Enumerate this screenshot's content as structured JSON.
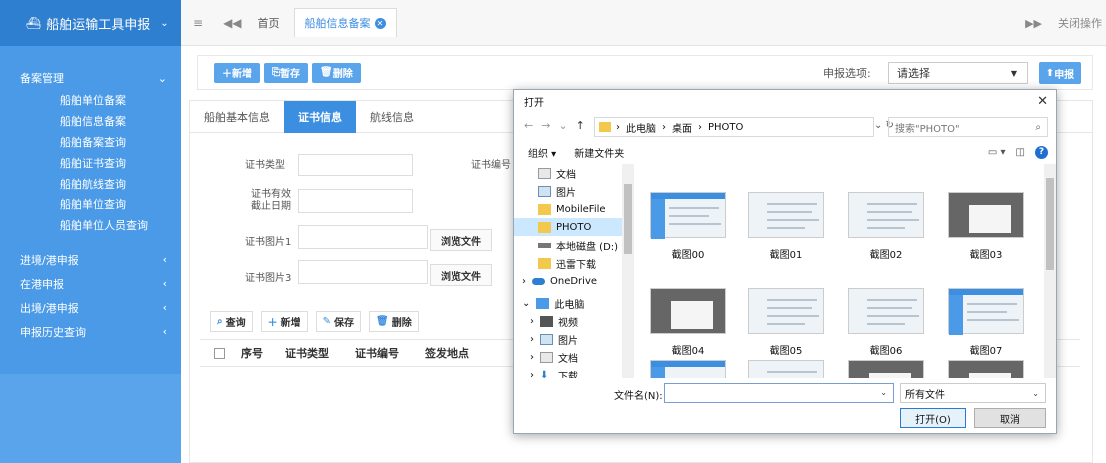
{
  "sidebar": {
    "title": "船舶运输工具申报",
    "section_main": "备案管理",
    "items": [
      "船舶单位备案",
      "船舶信息备案",
      "船舶备案查询",
      "船舶证书查询",
      "船舶航线查询",
      "船舶单位查询",
      "船舶单位人员查询"
    ],
    "sections": [
      "进境/港申报",
      "在港申报",
      "出境/港申报",
      "申报历史查询"
    ]
  },
  "topbar": {
    "home": "首页",
    "active_tab": "船舶信息备案",
    "close_ops": "关闭操作"
  },
  "toolbar": {
    "add": "新增",
    "save_draft": "暂存",
    "delete": "删除",
    "report_option_label": "申报选项:",
    "report_option_value": "请选择",
    "report": "申报"
  },
  "subtabs": [
    "船舶基本信息",
    "证书信息",
    "航线信息"
  ],
  "form": {
    "cert_type": "证书类型",
    "cert_no": "证书编号",
    "valid_until": "证书有效截止日期",
    "cert_image1": "证书图片1",
    "cert_image3": "证书图片3",
    "browse": "浏览文件"
  },
  "actions": {
    "query": "查询",
    "add": "新增",
    "save": "保存",
    "delete": "删除"
  },
  "table_headers": [
    "序号",
    "证书类型",
    "证书编号",
    "签发地点"
  ],
  "dialog": {
    "title": "打开",
    "path": [
      "此电脑",
      "桌面",
      "PHOTO"
    ],
    "search_placeholder": "搜索\"PHOTO\"",
    "organize": "组织 ▾",
    "new_folder": "新建文件夹",
    "nav": [
      "文档",
      "图片",
      "MobileFile",
      "PHOTO",
      "本地磁盘 (D:)",
      "迅雷下载",
      "OneDrive",
      "此电脑",
      "视频",
      "图片",
      "文档",
      "下载"
    ],
    "files": [
      "截图00",
      "截图01",
      "截图02",
      "截图03",
      "截图04",
      "截图05",
      "截图06",
      "截图07"
    ],
    "filename_label": "文件名(N):",
    "filetype": "所有文件",
    "open": "打开(O)",
    "cancel": "取消"
  },
  "colors": {
    "accent": "#3c8ee0",
    "sidebar": "#4a9ae8"
  }
}
